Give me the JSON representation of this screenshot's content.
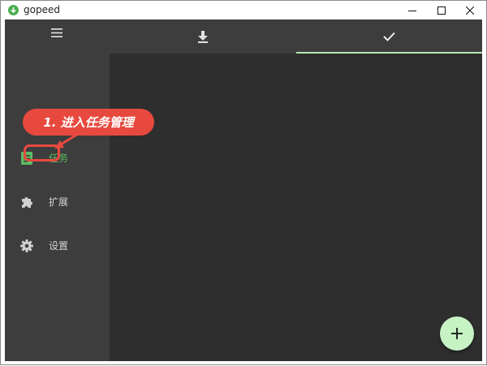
{
  "window": {
    "title": "gopeed",
    "minimize_icon": "minimize-icon",
    "maximize_icon": "maximize-icon",
    "close_icon": "close-icon"
  },
  "sidebar": {
    "menu_icon": "menu-icon",
    "items": [
      {
        "label": "任务",
        "icon": "task-icon",
        "active": true
      },
      {
        "label": "扩展",
        "icon": "puzzle-icon",
        "active": false
      },
      {
        "label": "设置",
        "icon": "gear-icon",
        "active": false
      }
    ]
  },
  "tabs": [
    {
      "icon": "download-icon",
      "selected": false
    },
    {
      "icon": "check-icon",
      "selected": true
    }
  ],
  "fab": {
    "icon": "plus-icon"
  },
  "annotation": {
    "text": "1. 进入任务管理"
  },
  "colors": {
    "accent": "#b8e6b4",
    "active_nav": "#5dbb63",
    "fab": "#c7f2c4",
    "annotation": "#e8493f",
    "sidebar_bg": "#3d3d3d",
    "content_bg": "#2e2e2e"
  }
}
